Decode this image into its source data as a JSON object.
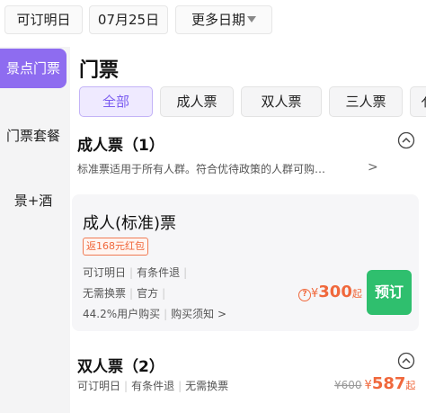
{
  "date_bar": {
    "chips": [
      "可订明日",
      "07月25日",
      "更多日期"
    ]
  },
  "sidebar": {
    "items": [
      {
        "label": "景点门票",
        "active": true
      },
      {
        "label": "门票套餐",
        "active": false
      },
      {
        "label": "景+酒",
        "active": false
      }
    ]
  },
  "main": {
    "title": "门票",
    "tabs": [
      {
        "label": "全部",
        "active": true
      },
      {
        "label": "成人票",
        "active": false
      },
      {
        "label": "双人票",
        "active": false
      },
      {
        "label": "三人票",
        "active": false
      },
      {
        "label": "亻",
        "active": false
      }
    ],
    "categories": [
      {
        "title": "成人票（1）",
        "description": "标准票适用于所有人群。符合优待政策的人群可购…",
        "product": {
          "name": "成人(标准)票",
          "tag": "返168元红包",
          "attrs_row1": [
            "可订明日",
            "有条件退"
          ],
          "attrs_row2": [
            "无需换票",
            "官方"
          ],
          "attrs_row3": [
            "44.2%用户购买",
            "购买须知"
          ],
          "price_currency": "¥",
          "price": "300",
          "price_suffix": "起",
          "book_label": "预订"
        }
      },
      {
        "title": "双人票（2）",
        "attrs": [
          "可订明日",
          "有条件退",
          "无需换票"
        ],
        "original_price": "¥600",
        "price_currency": "¥",
        "price": "587",
        "price_suffix": "起"
      }
    ]
  },
  "colors": {
    "accent": "#8e6cf0",
    "price": "#f0683c",
    "book_button": "#2fbf6e"
  }
}
